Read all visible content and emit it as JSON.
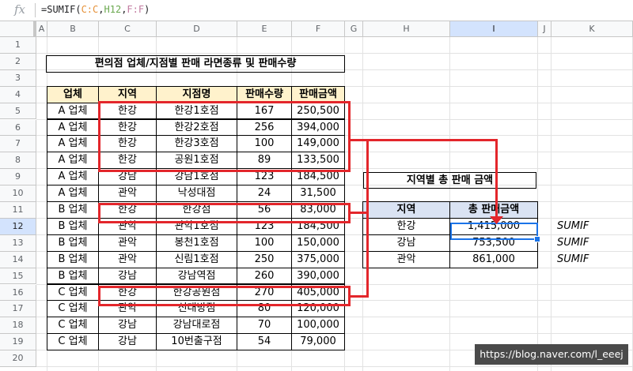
{
  "formula_bar": {
    "fx_symbol": "fx",
    "prefix": "=SUMIF(",
    "arg1": "C:C",
    "sep1": ",",
    "arg2": "H12",
    "sep2": ",",
    "arg3": "F:F",
    "suffix": ")"
  },
  "columns": [
    "A",
    "B",
    "C",
    "D",
    "E",
    "F",
    "G",
    "H",
    "I",
    "J",
    "K"
  ],
  "rows": [
    "1",
    "2",
    "3",
    "4",
    "5",
    "6",
    "7",
    "8",
    "9",
    "10",
    "11",
    "12",
    "13",
    "14",
    "15",
    "16",
    "17",
    "18",
    "19",
    "20"
  ],
  "selected_column": "I",
  "selected_row": "12",
  "title": "편의점 업체/지점별 판매 라면종류 및 판매수량",
  "table": {
    "headers": [
      "업체",
      "지역",
      "지점명",
      "판매수량",
      "판매금액"
    ],
    "rows": [
      [
        "A 업체",
        "한강",
        "한강1호점",
        "167",
        "250,500"
      ],
      [
        "A 업체",
        "한강",
        "한강2호점",
        "256",
        "394,000"
      ],
      [
        "A 업체",
        "한강",
        "한강3호점",
        "100",
        "149,000"
      ],
      [
        "A 업체",
        "한강",
        "공원1호점",
        "89",
        "133,500"
      ],
      [
        "A 업체",
        "강남",
        "강남1호점",
        "123",
        "184,500"
      ],
      [
        "A 업체",
        "관악",
        "낙성대점",
        "24",
        "31,500"
      ],
      [
        "B 업체",
        "한강",
        "한강점",
        "56",
        "83,000"
      ],
      [
        "B 업체",
        "관악",
        "관악1호점",
        "123",
        "184,500"
      ],
      [
        "B 업체",
        "관악",
        "봉천1호점",
        "100",
        "150,000"
      ],
      [
        "B 업체",
        "관악",
        "신림1호점",
        "250",
        "375,000"
      ],
      [
        "B 업체",
        "강남",
        "강남역점",
        "260",
        "390,000"
      ],
      [
        "C 업체",
        "한강",
        "한강공원점",
        "270",
        "405,000"
      ],
      [
        "C 업체",
        "관악",
        "신대방점",
        "80",
        "120,000"
      ],
      [
        "C 업체",
        "강남",
        "강남대로점",
        "70",
        "100,000"
      ],
      [
        "C 업체",
        "강남",
        "10번출구점",
        "54",
        "79,000"
      ]
    ]
  },
  "summary": {
    "title": "지역별 총 판매 금액",
    "headers": [
      "지역",
      "총 판매금액"
    ],
    "rows": [
      [
        "한강",
        "1,415,000"
      ],
      [
        "강남",
        "753,500"
      ],
      [
        "관악",
        "861,000"
      ]
    ],
    "formula_labels": [
      "SUMIF",
      "SUMIF",
      "SUMIF"
    ]
  },
  "watermark": "https://blog.naver.com/l_eeej",
  "colors": {
    "header_yellow": "#fff2cc",
    "header_blue": "#dae3f3",
    "highlight_red": "#e3262b",
    "selection_blue": "#1a73e8"
  }
}
